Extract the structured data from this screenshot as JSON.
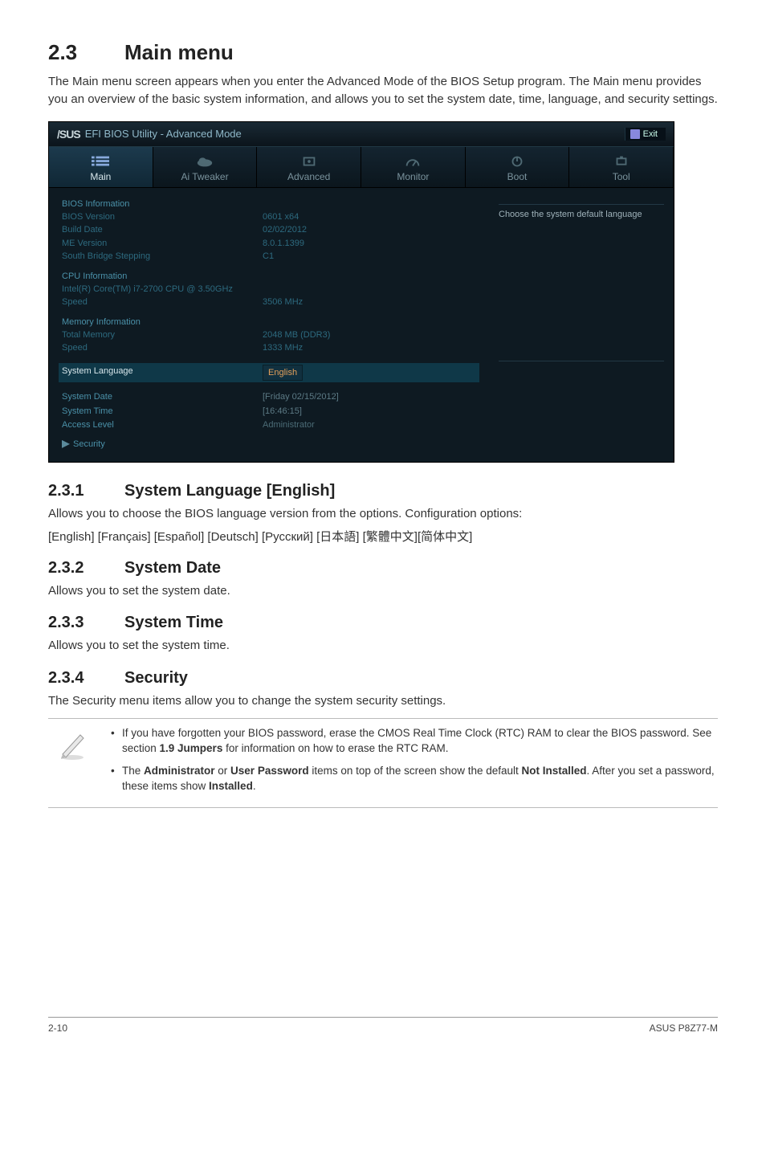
{
  "section": {
    "number": "2.3",
    "title": "Main menu"
  },
  "intro": "The Main menu screen appears when you enter the Advanced Mode of the BIOS Setup program. The Main menu provides you an overview of the basic system information, and allows you to set the system date, time, language, and security settings.",
  "bios": {
    "logo": "/SUS",
    "subtitle": "EFI BIOS Utility - Advanced Mode",
    "exit_label": "Exit",
    "tabs": {
      "main": "Main",
      "ai_tweaker": "Ai Tweaker",
      "advanced": "Advanced",
      "monitor": "Monitor",
      "boot": "Boot",
      "tool": "Tool"
    },
    "right_help": "Choose the system default language",
    "bios_info": {
      "heading": "BIOS Information",
      "version_label": "BIOS Version",
      "version_value": "0601 x64",
      "build_label": "Build Date",
      "build_value": "02/02/2012",
      "me_label": "ME Version",
      "me_value": "8.0.1.1399",
      "sb_label": "South Bridge Stepping",
      "sb_value": "C1"
    },
    "cpu_info": {
      "heading": "CPU Information",
      "name": "Intel(R) Core(TM) i7-2700 CPU  @ 3.50GHz",
      "speed_label": "Speed",
      "speed_value": "3506 MHz"
    },
    "mem_info": {
      "heading": "Memory Information",
      "total_label": "Total Memory",
      "total_value": "2048 MB (DDR3)",
      "speed_label": "Speed",
      "speed_value": "1333 MHz"
    },
    "lang": {
      "label": "System Language",
      "value": "English"
    },
    "date": {
      "label": "System Date",
      "value": "[Friday 02/15/2012]"
    },
    "time": {
      "label": "System Time",
      "value": "[16:46:15]"
    },
    "access": {
      "label": "Access Level",
      "value": "Administrator"
    },
    "security": {
      "label": "Security"
    }
  },
  "s231": {
    "num": "2.3.1",
    "title": "System Language [English]",
    "body": "Allows you to choose the BIOS language version from the options. Configuration options:",
    "options": "[English] [Français] [Español] [Deutsch] [Русский] [日本語] [繁體中文][简体中文]"
  },
  "s232": {
    "num": "2.3.2",
    "title": "System Date",
    "body": "Allows you to set the system date."
  },
  "s233": {
    "num": "2.3.3",
    "title": "System Time",
    "body": "Allows you to set the system time."
  },
  "s234": {
    "num": "2.3.4",
    "title": "Security",
    "body": "The Security menu items allow you to change the system security settings."
  },
  "note": {
    "b1a": "If you have forgotten your BIOS password, erase the CMOS Real Time Clock (RTC) RAM to clear the BIOS password. See section ",
    "b1b": "1.9 Jumpers",
    "b1c": " for information on how to erase the RTC RAM.",
    "b2a": "The ",
    "b2b": "Administrator",
    "b2c": " or ",
    "b2d": "User Password",
    "b2e": " items on top of the screen show the default ",
    "b2f": "Not Installed",
    "b2g": ". After you set a password, these items show ",
    "b2h": "Installed",
    "b2i": "."
  },
  "footer": {
    "page": "2-10",
    "product": "ASUS P8Z77-M"
  }
}
